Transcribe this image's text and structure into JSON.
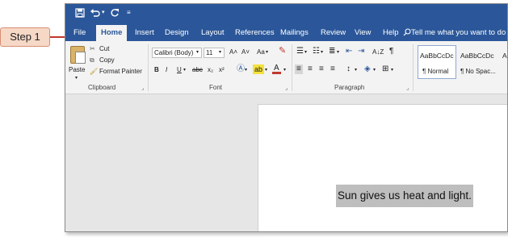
{
  "callout": {
    "label": "Step 1"
  },
  "qat": {
    "save_icon": "save-icon",
    "undo_icon": "undo-icon",
    "redo_icon": "redo-icon",
    "customize_icon": "customize-icon"
  },
  "tabs": [
    {
      "label": "File"
    },
    {
      "label": "Home"
    },
    {
      "label": "Insert"
    },
    {
      "label": "Design"
    },
    {
      "label": "Layout"
    },
    {
      "label": "References"
    },
    {
      "label": "Mailings"
    },
    {
      "label": "Review"
    },
    {
      "label": "View"
    },
    {
      "label": "Help"
    }
  ],
  "tell_me": {
    "placeholder": "Tell me what you want to do"
  },
  "clipboard": {
    "paste": "Paste",
    "cut": "Cut",
    "copy": "Copy",
    "format_painter": "Format Painter",
    "label": "Clipboard"
  },
  "font": {
    "name": "Calibri (Body)",
    "size": "11",
    "label": "Font",
    "bold": "B",
    "italic": "I",
    "underline": "U",
    "strike": "abc",
    "subscript": "x₂",
    "superscript": "x²",
    "grow": "A˄",
    "shrink": "A˅",
    "case": "Aa",
    "font_color": "A"
  },
  "paragraph": {
    "label": "Paragraph",
    "sort": "A↓Z",
    "pilcrow": "¶"
  },
  "styles": [
    {
      "sample": "AaBbCcDc",
      "name": "¶ Normal"
    },
    {
      "sample": "AaBbCcDc",
      "name": "¶ No Spac..."
    },
    {
      "sample": "A",
      "name": ""
    }
  ],
  "document": {
    "text": "Sun gives us heat and light."
  },
  "colors": {
    "accent": "#2b579a",
    "callout_bg": "#f6d8c7",
    "arrow": "#c0392b",
    "highlight": "#bebebe"
  }
}
